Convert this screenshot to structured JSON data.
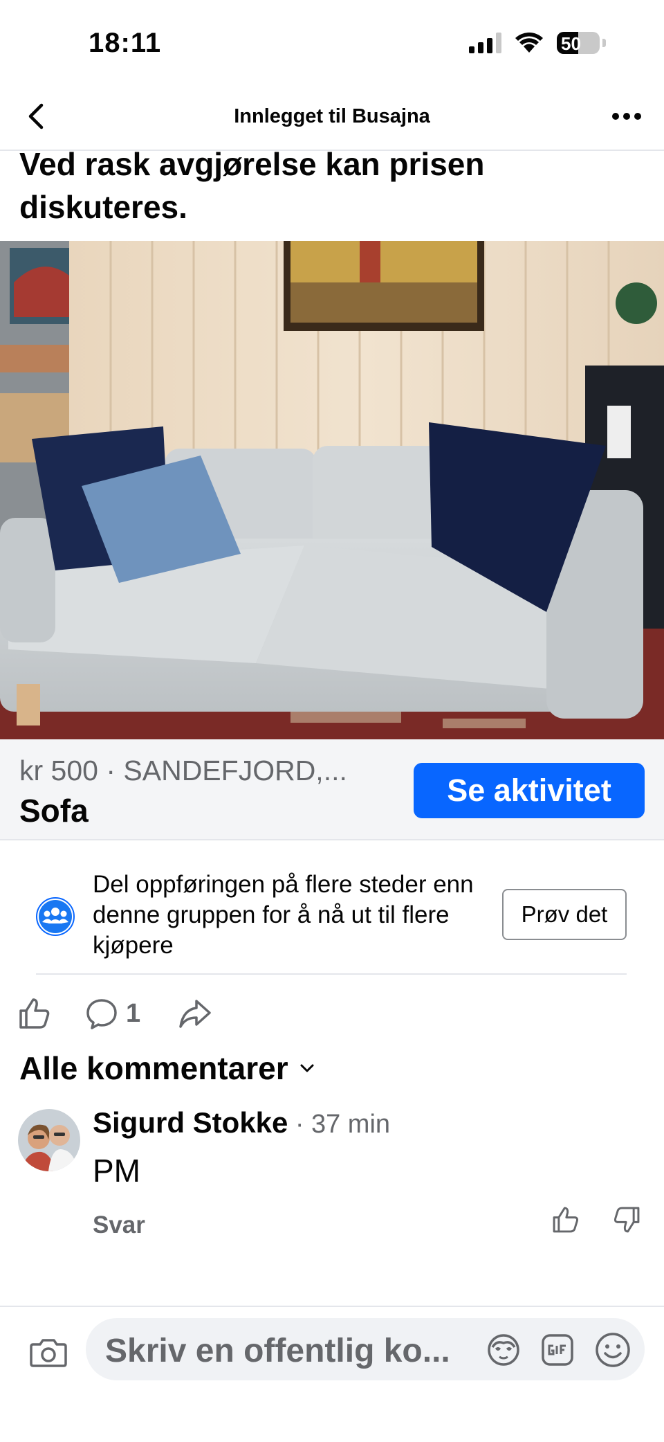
{
  "status_bar": {
    "time": "18:11",
    "battery": "50",
    "battery_level": 0.5
  },
  "nav": {
    "title": "Innlegget til Busajna"
  },
  "post": {
    "text": "Ved rask avgjørelse kan prisen diskuteres."
  },
  "listing": {
    "meta": "kr 500 · SANDEFJORD,...",
    "title": "Sofa",
    "cta_label": "Se aktivitet"
  },
  "share_promo": {
    "text": "Del oppføringen på flere steder enn denne gruppen for å nå ut til flere kjøpere",
    "button_label": "Prøv det"
  },
  "actions": {
    "comment_count": "1"
  },
  "comments": {
    "sort_label": "Alle kommentarer",
    "items": [
      {
        "author": "Sigurd Stokke",
        "separator": "·",
        "time": "37 min",
        "text": "PM",
        "reply_label": "Svar"
      }
    ]
  },
  "composer": {
    "placeholder": "Skriv en offentlig ko..."
  },
  "colors": {
    "accent": "#0866ff",
    "text_primary": "#050505",
    "text_secondary": "#65676b",
    "divider": "#e4e6eb",
    "listing_bar_bg": "#f4f5f7"
  },
  "icons": {
    "back": "back-icon",
    "more": "more-icon",
    "like": "like-icon",
    "comment": "comment-icon",
    "share": "share-icon",
    "group": "group-icon",
    "chevron": "chevron-down-icon",
    "camera": "camera-icon",
    "avatar_sticker": "avatar-sticker-icon",
    "gif": "gif-icon",
    "emoji": "emoji-icon"
  }
}
